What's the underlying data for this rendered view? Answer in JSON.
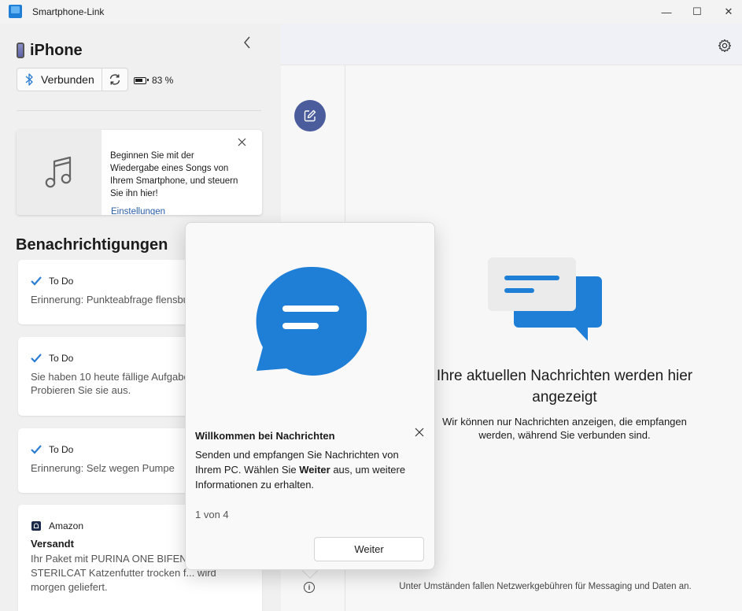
{
  "window": {
    "title": "Smartphone-Link",
    "minimize": "—",
    "maximize": "☐",
    "close": "✕"
  },
  "device": {
    "name": "iPhone",
    "connection_label": "Verbunden",
    "battery": "83 %"
  },
  "music_card": {
    "text": "Beginnen Sie mit der Wiedergabe eines Songs von Ihrem Smartphone, und steuern Sie ihn hier!",
    "link": "Einstellungen"
  },
  "notifications": {
    "heading": "Benachrichtigungen",
    "items": [
      {
        "app": "To Do",
        "body": "Erinnerung: Punkteabfrage flensburg"
      },
      {
        "app": "To Do",
        "body": "Sie haben 10 heute fällige Aufgaben.",
        "body2": "Probieren Sie sie aus."
      },
      {
        "app": "To Do",
        "body": "Erinnerung: Selz wegen Pumpe"
      },
      {
        "app": "Amazon",
        "title": "Versandt",
        "body": "Ihr Paket mit PURINA ONE BIFENSIS",
        "body2": "STERILCAT Katzenfutter trocken f... wird",
        "body3": "morgen geliefert."
      }
    ]
  },
  "messages": {
    "empty_title": "Ihre aktuellen Nachrichten werden hier angezeigt",
    "empty_sub": "Wir können nur Nachrichten anzeigen, die empfangen werden, während Sie verbunden sind.",
    "footer": "Unter Umständen fallen Netzwerkgebühren für Messaging und Daten an.",
    "info_glyph": "i"
  },
  "teaching_tip": {
    "title": "Willkommen bei Nachrichten",
    "body_pre": "Senden und empfangen Sie Nachrichten von Ihrem PC. Wählen Sie ",
    "body_bold": "Weiter",
    "body_post": " aus, um weitere Informationen zu erhalten.",
    "counter": "1 von 4",
    "next_label": "Weiter",
    "close_glyph": "✕"
  },
  "icons": {
    "app": "smartphone-link-icon",
    "phone": "phone-icon",
    "bluetooth": "bluetooth-icon",
    "sync": "sync-icon",
    "battery": "battery-icon",
    "collapse": "chevron-left-icon",
    "music": "music-note-icon",
    "check": "checkmark-icon",
    "bell": "bell-icon",
    "settings": "gear-icon",
    "compose": "compose-icon",
    "info": "info-icon"
  },
  "colors": {
    "accent": "#1f7fd6",
    "compose_bg": "#4a5c9c",
    "todo_check": "#2b7cd3",
    "link": "#2a5ea8"
  }
}
